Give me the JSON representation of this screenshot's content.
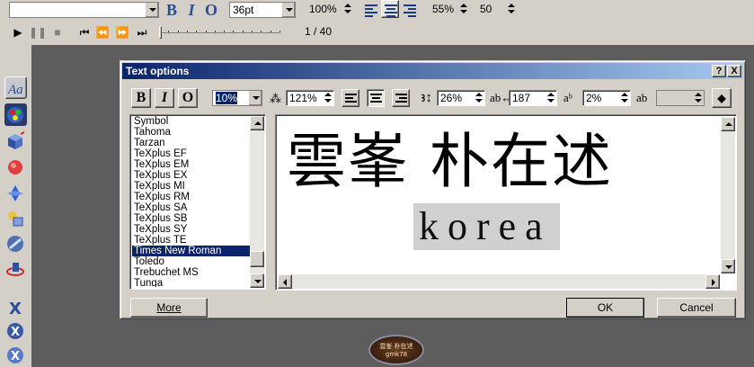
{
  "toolbar": {
    "font_size": "36pt",
    "zoom": "100%",
    "percent1": "55%",
    "value2": "50",
    "bold_label": "B",
    "italic_label": "I",
    "outline_label": "O"
  },
  "player": {
    "page_counter": "1 / 40",
    "progress": 0.0
  },
  "dialog": {
    "title": "Text options",
    "help_label": "?",
    "close_label": "X",
    "bold_label": "B",
    "italic_label": "I",
    "outline_label": "O",
    "style_value": "10%",
    "char_spacing": "121%",
    "line_spacing": "26%",
    "width_value": "187",
    "baseline_value": "2%",
    "extra_value": "",
    "fonts": [
      "Symbol",
      "Tahoma",
      "Tarzan",
      "TeXplus EF",
      "TeXplus EM",
      "TeXplus EX",
      "TeXplus MI",
      "TeXplus RM",
      "TeXplus SA",
      "TeXplus SB",
      "TeXplus SY",
      "TeXplus TE",
      "Times New Roman",
      "Toledo",
      "Trebuchet MS",
      "Tunga"
    ],
    "selected_font": "Times New Roman",
    "preview_main": "雲峯 朴在述",
    "preview_sub": "korea",
    "more_label": "More",
    "ok_label": "OK",
    "cancel_label": "Cancel"
  },
  "logo": {
    "line1": "雲峯 朴在述",
    "line2": "gmk78"
  },
  "colors": {
    "accent": "#0a246a",
    "face": "#d4d0c8",
    "workspace": "#5d5d5d"
  }
}
